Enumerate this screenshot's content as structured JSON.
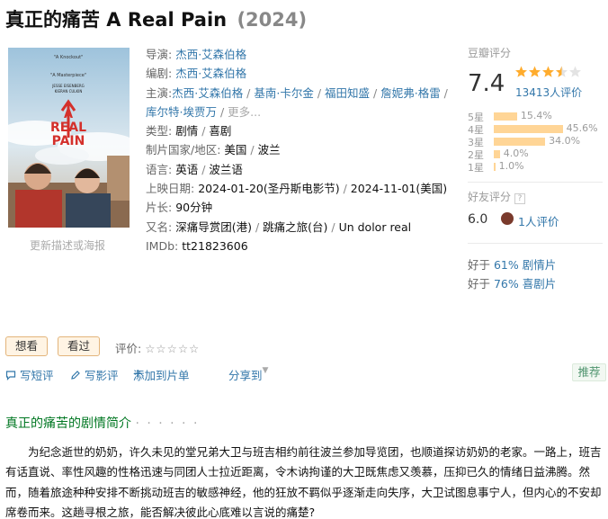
{
  "title": {
    "main": "真正的痛苦 A Real Pain",
    "year": "(2024)"
  },
  "poster": {
    "quote1": "\"A Knockout\"",
    "quote2": "\"A Masterpiece\"",
    "actor1": "JESSE EISENBERG",
    "actor2": "KIERAN CULKIN",
    "title_line1": "A",
    "title_line2": "REAL",
    "title_line3": "PAIN"
  },
  "update_poster": "更新描述或海报",
  "info": {
    "director_label": "导演:",
    "director": "杰西·艾森伯格",
    "writer_label": "编剧:",
    "writer": "杰西·艾森伯格",
    "cast_label": "主演:",
    "cast": [
      "杰西·艾森伯格",
      "基南·卡尔金",
      "福田知盛",
      "詹妮弗·格雷",
      "库尔特·埃贾万"
    ],
    "cast_more": "更多...",
    "genre_label": "类型:",
    "genre": [
      "剧情",
      "喜剧"
    ],
    "country_label": "制片国家/地区:",
    "country": [
      "美国",
      "波兰"
    ],
    "language_label": "语言:",
    "language": [
      "英语",
      "波兰语"
    ],
    "release_label": "上映日期:",
    "release": [
      "2024-01-20(圣丹斯电影节)",
      "2024-11-01(美国)"
    ],
    "runtime_label": "片长:",
    "runtime": "90分钟",
    "aka_label": "又名:",
    "aka": [
      "深痛导赏团(港)",
      "跳痛之旅(台)",
      "Un dolor real"
    ],
    "imdb_label": "IMDb:",
    "imdb": "tt21823606",
    "separator": " / "
  },
  "rating": {
    "header": "豆瓣评分",
    "score": "7.4",
    "stars_value": 3.5,
    "count": "13413人评价",
    "star_color": "#ffac2d",
    "bar_color": "#ffd596",
    "distribution": [
      {
        "label": "5星",
        "pct": "15.4%",
        "value": 15.4
      },
      {
        "label": "4星",
        "pct": "45.6%",
        "value": 45.6
      },
      {
        "label": "3星",
        "pct": "34.0%",
        "value": 34.0
      },
      {
        "label": "2星",
        "pct": "4.0%",
        "value": 4.0
      },
      {
        "label": "1星",
        "pct": "1.0%",
        "value": 1.0
      }
    ]
  },
  "friend": {
    "header": "好友评分",
    "help": "?",
    "score": "6.0",
    "count": "1人评价"
  },
  "better_than": [
    {
      "prefix": "好于 ",
      "pct": "61%",
      "genre": " 剧情片"
    },
    {
      "prefix": "好于 ",
      "pct": "76%",
      "genre": " 喜剧片"
    }
  ],
  "actions": {
    "want": "想看",
    "seen": "看过",
    "rate_label": "评价:",
    "empty_stars": "☆☆☆☆☆"
  },
  "ops": {
    "short_review": "写短评",
    "review": "写影评",
    "add_list": "添加到片单",
    "share": "分享到",
    "recommend": "推荐"
  },
  "summary": {
    "title": "真正的痛苦的剧情简介",
    "dots": "· · · · · ·",
    "text": "为纪念逝世的奶奶，许久未见的堂兄弟大卫与班吉相约前往波兰参加导览团，也顺道探访奶奶的老家。一路上，班吉有话直说、率性风趣的性格迅速与同团人士拉近距离，令木讷拘谨的大卫既焦虑又羡慕，压抑已久的情绪日益沸腾。然而，随着旅途种种安排不断挑动班吉的敏感神经，他的狂放不羁似乎逐渐走向失序，大卫试图息事宁人，但内心的不安却席卷而来。这趟寻根之旅，能否解决彼此心底难以言说的痛楚?"
  }
}
